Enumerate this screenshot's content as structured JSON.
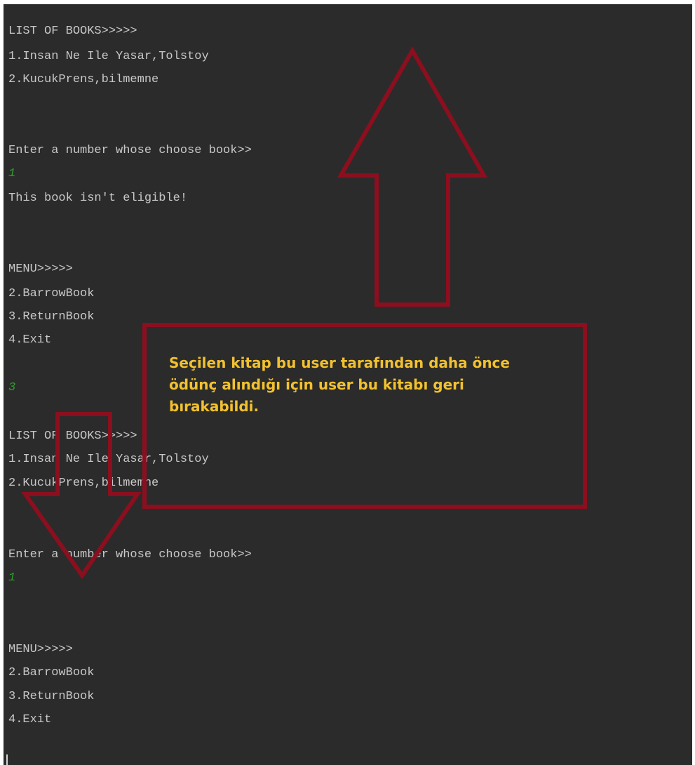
{
  "console": {
    "lines": [
      {
        "text": "LIST OF BOOKS>>>>>",
        "kind": "output"
      },
      {
        "text": "1.Insan Ne Ile Yasar,Tolstoy",
        "kind": "output"
      },
      {
        "text": "2.KucukPrens,bilmemne",
        "kind": "output"
      },
      {
        "text": "Enter a number whose choose book>>",
        "kind": "output"
      },
      {
        "text": "1",
        "kind": "input"
      },
      {
        "text": "This book isn't eligible!",
        "kind": "output"
      },
      {
        "text": "MENU>>>>>",
        "kind": "output"
      },
      {
        "text": "2.BarrowBook",
        "kind": "output"
      },
      {
        "text": "3.ReturnBook",
        "kind": "output"
      },
      {
        "text": "4.Exit",
        "kind": "output"
      },
      {
        "text": "3",
        "kind": "input"
      },
      {
        "text": "LIST OF BOOKS>>>>>",
        "kind": "output"
      },
      {
        "text": "1.Insan Ne Ile Yasar,Tolstoy",
        "kind": "output"
      },
      {
        "text": "2.KucukPrens,bilmemne",
        "kind": "output"
      },
      {
        "text": "Enter a number whose choose book>>",
        "kind": "output"
      },
      {
        "text": "1",
        "kind": "input"
      },
      {
        "text": "MENU>>>>>",
        "kind": "output"
      },
      {
        "text": "2.BarrowBook",
        "kind": "output"
      },
      {
        "text": "3.ReturnBook",
        "kind": "output"
      },
      {
        "text": "4.Exit",
        "kind": "output"
      }
    ]
  },
  "annotation": {
    "text": "Seçilen kitap bu user tarafından daha önce ödünç alındığı için user bu kitabı geri bırakabildi.",
    "text_color": "#f2c12e",
    "border_color": "#8b0f1e"
  },
  "arrows": {
    "up": {
      "direction": "up",
      "color": "#8b0f1e",
      "icon": "arrow-up-icon"
    },
    "down": {
      "direction": "down",
      "color": "#8b0f1e",
      "icon": "arrow-down-icon"
    }
  }
}
